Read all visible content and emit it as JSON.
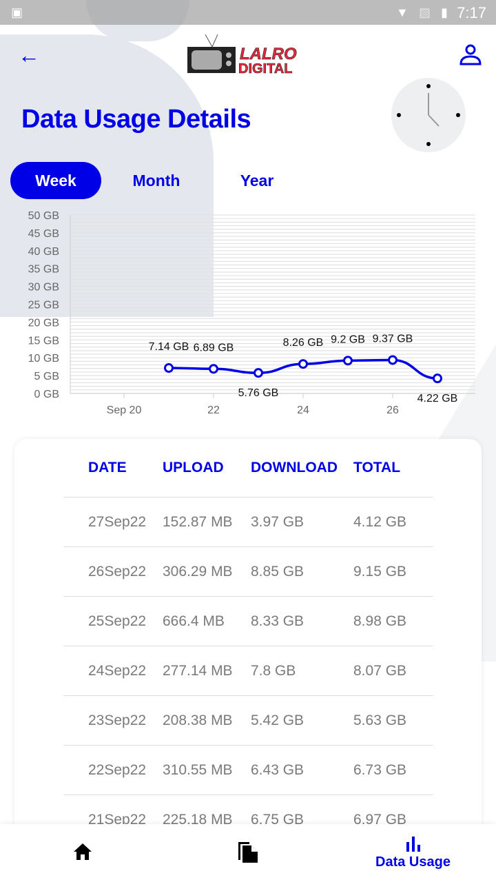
{
  "status_bar": {
    "time": "7:17"
  },
  "header": {
    "logo_text": "LALRO DIGITAL",
    "title": "Data Usage Details"
  },
  "tabs": [
    {
      "label": "Week",
      "active": true
    },
    {
      "label": "Month",
      "active": false
    },
    {
      "label": "Year",
      "active": false
    }
  ],
  "colors": {
    "accent": "#0000e6",
    "logo_red": "#e8283c"
  },
  "chart_data": {
    "type": "line",
    "x": [
      "2022-09-21",
      "2022-09-22",
      "2022-09-23",
      "2022-09-24",
      "2022-09-25",
      "2022-09-26",
      "2022-09-27"
    ],
    "values": [
      7.14,
      6.89,
      5.76,
      8.26,
      9.2,
      9.37,
      4.22
    ],
    "data_labels": [
      "7.14 GB",
      "6.89 GB",
      "5.76 GB",
      "8.26 GB",
      "9.2 GB",
      "9.37 GB",
      "4.22 GB"
    ],
    "ylim": [
      0,
      50
    ],
    "yticks": [
      "0 GB",
      "5 GB",
      "10 GB",
      "15 GB",
      "20 GB",
      "25 GB",
      "30 GB",
      "35 GB",
      "40 GB",
      "45 GB",
      "50 GB"
    ],
    "xticks": [
      {
        "date": "2022-09-20",
        "label": "Sep 20"
      },
      {
        "date": "2022-09-22",
        "label": "22"
      },
      {
        "date": "2022-09-24",
        "label": "24"
      },
      {
        "date": "2022-09-26",
        "label": "26"
      }
    ],
    "grid": true,
    "line_color": "#0000e6"
  },
  "table": {
    "headers": [
      "DATE",
      "UPLOAD",
      "DOWNLOAD",
      "TOTAL"
    ],
    "rows": [
      [
        "27Sep22",
        "152.87 MB",
        "3.97 GB",
        "4.12 GB"
      ],
      [
        "26Sep22",
        "306.29 MB",
        "8.85 GB",
        "9.15 GB"
      ],
      [
        "25Sep22",
        "666.4 MB",
        "8.33 GB",
        "8.98 GB"
      ],
      [
        "24Sep22",
        "277.14 MB",
        "7.8 GB",
        "8.07 GB"
      ],
      [
        "23Sep22",
        "208.38 MB",
        "5.42 GB",
        "5.63 GB"
      ],
      [
        "22Sep22",
        "310.55 MB",
        "6.43 GB",
        "6.73 GB"
      ],
      [
        "21Sep22",
        "225.18 MB",
        "6.75 GB",
        "6.97 GB"
      ]
    ]
  },
  "bottom_nav": {
    "items": [
      {
        "icon": "home-icon"
      },
      {
        "icon": "documents-icon"
      },
      {
        "icon": "bar-chart-icon",
        "label": "Data Usage",
        "active": true
      }
    ]
  }
}
